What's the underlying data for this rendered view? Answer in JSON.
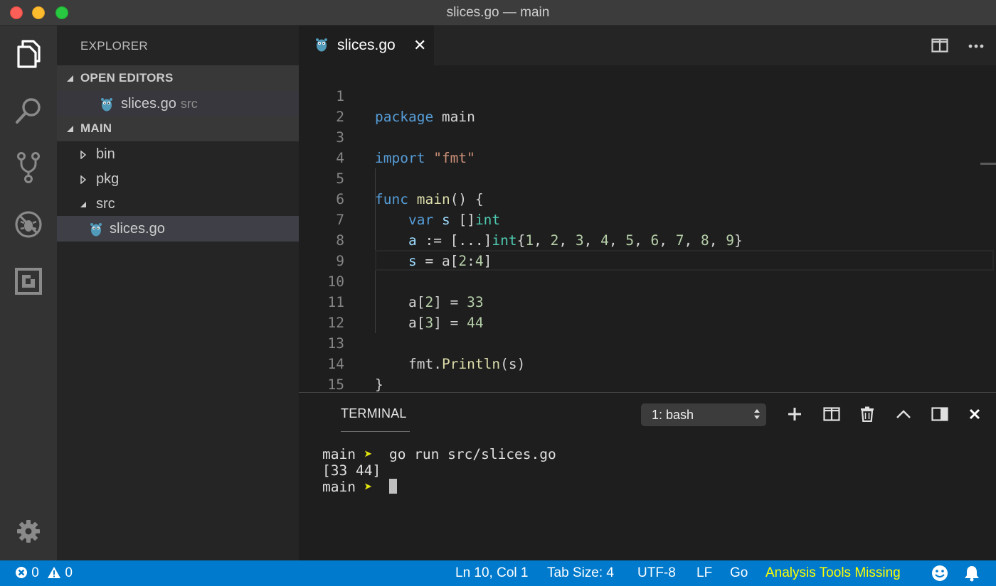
{
  "window": {
    "title": "slices.go — main"
  },
  "activity_bar": {
    "items": [
      "files-icon",
      "search-icon",
      "source-control-icon",
      "debug-icon",
      "extensions-icon",
      "settings-gear-icon"
    ]
  },
  "sidebar": {
    "title": "EXPLORER",
    "open_editors": {
      "header": "OPEN EDITORS",
      "items": [
        {
          "name": "slices.go",
          "description": "src"
        }
      ]
    },
    "folder": {
      "header": "MAIN",
      "items": [
        {
          "name": "bin",
          "expanded": false
        },
        {
          "name": "pkg",
          "expanded": false
        },
        {
          "name": "src",
          "expanded": true
        },
        {
          "name": "slices.go",
          "selected": true
        }
      ]
    }
  },
  "editor": {
    "tab": {
      "label": "slices.go",
      "close": "✕"
    },
    "line_numbers": [
      "1",
      "2",
      "3",
      "4",
      "5",
      "6",
      "7",
      "8",
      "9",
      "10",
      "11",
      "12",
      "13",
      "14",
      "15"
    ],
    "code": {
      "l1_kw": "package",
      "l1_rest": " main",
      "l3_kw": "import",
      "l3_str": "\"fmt\"",
      "l5_kw": "func",
      "l5_fn": "main",
      "l5_rest": "() {",
      "l6_kw": "var",
      "l6_var": "s",
      "l6_br": "[]",
      "l6_ty": "int",
      "l7_var": "a",
      "l7_op": " := [...]",
      "l7_ty": "int",
      "l7_open": "{",
      "l7_nums": [
        "1",
        "2",
        "3",
        "4",
        "5",
        "6",
        "7",
        "8",
        "9"
      ],
      "l7_close": "}",
      "l8_var": "s",
      "l8_rest": " = a[",
      "l8_n1": "2",
      "l8_colon": ":",
      "l8_n2": "4",
      "l8_end": "]",
      "l10_a": "a[",
      "l10_i": "2",
      "l10_mid": "] = ",
      "l10_v": "33",
      "l11_a": "a[",
      "l11_i": "3",
      "l11_mid": "] = ",
      "l11_v": "44",
      "l13_pkg": "fmt.",
      "l13_fn": "Println",
      "l13_rest": "(s)",
      "l14": "}"
    }
  },
  "panel": {
    "tab": "TERMINAL",
    "terminal_select": "1: bash",
    "lines": [
      {
        "dir": "main",
        "arrow": "➤",
        "cmd": "go run src/slices.go"
      },
      {
        "output": "[33 44]"
      },
      {
        "dir": "main",
        "arrow": "➤",
        "cmd": ""
      }
    ]
  },
  "statusbar": {
    "errors": "0",
    "warnings": "0",
    "position": "Ln 10, Col 1",
    "tab_size": "Tab Size: 4",
    "encoding": "UTF-8",
    "eol": "LF",
    "language": "Go",
    "warning_text": "Analysis Tools Missing"
  },
  "colors": {
    "status_bar": "#007acc",
    "keyword": "#569cd6",
    "type": "#4ec9b0",
    "string": "#ce9178",
    "number": "#b5cea8",
    "function": "#dcdcaa",
    "variable": "#9cdcfe",
    "analysis_warning": "#ffff00"
  }
}
